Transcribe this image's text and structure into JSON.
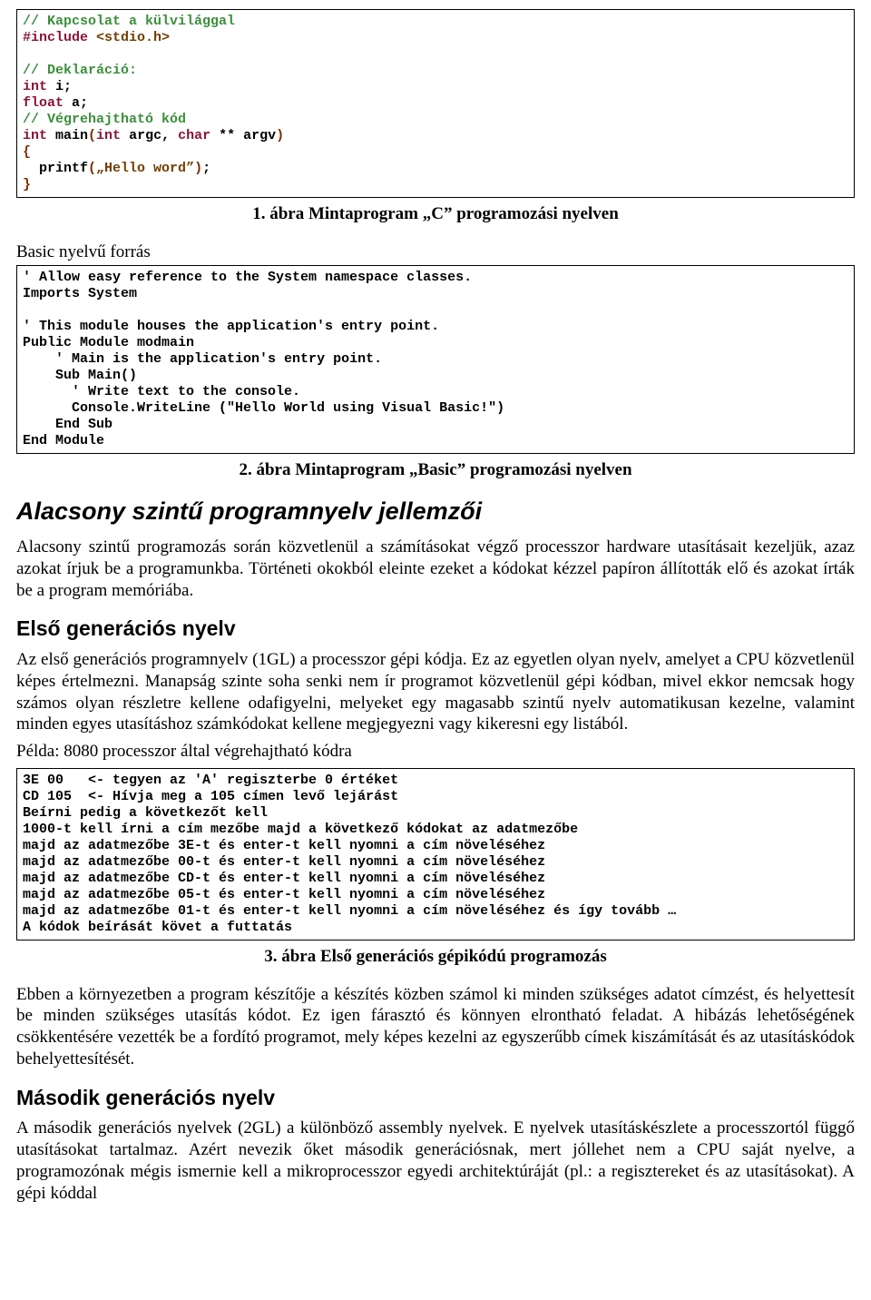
{
  "code1": {
    "l1": "// Kapcsolat a külvilággal",
    "l2a": "#include",
    "l2b": " <stdio.h>",
    "l3": "",
    "l4": "// Deklaráció:",
    "l5a": "int",
    "l5b": " i;",
    "l6a": "float",
    "l6b": " a;",
    "l7": "// Végrehajtható kód",
    "l8a": "int",
    "l8b": " main",
    "l8c": "(",
    "l8d": "int",
    "l8e": " argc, ",
    "l8f": "char",
    "l8g": " ** argv",
    "l8h": ")",
    "l9": "{",
    "l10a": "  printf",
    "l10b": "(",
    "l10c": "„Hello word”",
    "l10d": ")",
    "l10e": ";",
    "l11": "}"
  },
  "caption1": "1. ábra Mintaprogram „C” programozási nyelven",
  "basic_lead": "Basic nyelvű forrás",
  "code2": {
    "l1": "' Allow easy reference to the System namespace classes.",
    "l2": "Imports System",
    "l3": "",
    "l4": "' This module houses the application's entry point.",
    "l5": "Public Module modmain",
    "l6": "    ' Main is the application's entry point.",
    "l7": "    Sub Main()",
    "l8": "      ' Write text to the console.",
    "l9": "      Console.WriteLine (\"Hello World using Visual Basic!\")",
    "l10": "    End Sub",
    "l11": "End Module"
  },
  "caption2": "2. ábra Mintaprogram „Basic” programozási nyelven",
  "h1": "Alacsony szintű programnyelv jellemzői",
  "p1": "Alacsony szintű programozás során közvetlenül a számításokat végző processzor hardware utasításait kezeljük, azaz azokat írjuk be a programunkba. Történeti okokból eleinte ezeket a kódokat kézzel papíron állították elő és azokat írták be a program memóriába.",
  "h2a": "Első generációs nyelv",
  "p2": "Az első generációs programnyelv (1GL) a processzor gépi kódja. Ez az egyetlen olyan nyelv, amelyet a CPU közvetlenül képes értelmezni. Manapság szinte soha senki nem ír programot közvetlenül gépi kódban, mivel ekkor nemcsak hogy számos olyan részletre kellene odafigyelni, melyeket egy magasabb szintű nyelv automatikusan kezelne, valamint minden egyes utasításhoz számkódokat kellene megjegyezni vagy kikeresni egy listából.",
  "p3": "Példa: 8080 processzor által végrehajtható kódra",
  "code3": {
    "l1": "3E 00   <- tegyen az 'A' regiszterbe 0 értéket",
    "l2": "CD 105  <- Hívja meg a 105 címen levő lejárást",
    "l3": "Beírni pedig a következőt kell",
    "l4": "1000-t kell írni a cím mezőbe majd a következő kódokat az adatmezőbe",
    "l5": "majd az adatmezőbe 3E-t és enter-t kell nyomni a cím növeléséhez",
    "l6": "majd az adatmezőbe 00-t és enter-t kell nyomni a cím növeléséhez",
    "l7": "majd az adatmezőbe CD-t és enter-t kell nyomni a cím növeléséhez",
    "l8": "majd az adatmezőbe 05-t és enter-t kell nyomni a cím növeléséhez",
    "l9": "majd az adatmezőbe 01-t és enter-t kell nyomni a cím növeléséhez és így tovább …",
    "l10": "A kódok beírását követ a futtatás"
  },
  "caption3": "3. ábra Első generációs gépikódú programozás",
  "p4": "Ebben a környezetben a program készítője a készítés közben számol ki minden szükséges adatot címzést, és helyettesít be minden szükséges utasítás kódot. Ez igen fárasztó és könnyen elrontható feladat. A hibázás lehetőségének csökkentésére vezették be a fordító programot, mely képes kezelni az egyszerűbb címek kiszámítását és az utasításkódok behelyettesítését.",
  "h2b": "Második generációs nyelv",
  "p5": "A második generációs nyelvek (2GL) a különböző assembly nyelvek. E nyelvek utasításkészlete a processzortól függő utasításokat tartalmaz. Azért nevezik őket második generációsnak, mert jóllehet nem a CPU saját nyelve, a programozónak mégis ismernie kell a mikroprocesszor egyedi architektúráját (pl.: a regisztereket és az utasításokat). A gépi kóddal"
}
